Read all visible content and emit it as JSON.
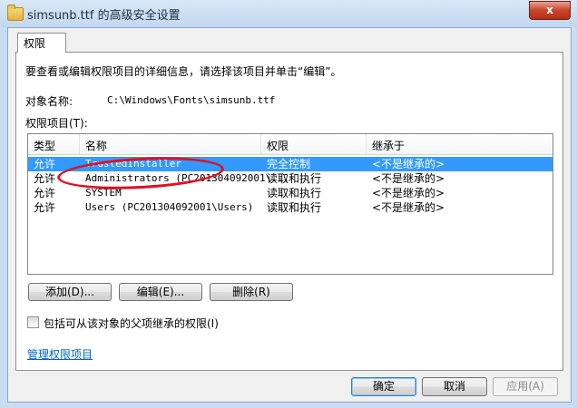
{
  "window": {
    "title": "simsunb.ttf 的高级安全设置",
    "close_label": "x"
  },
  "tab": {
    "label": "权限"
  },
  "intro": "要查看或编辑权限项目的详细信息，请选择该项目并单击“编辑”。",
  "object": {
    "label": "对象名称:",
    "value": "C:\\Windows\\Fonts\\simsunb.ttf"
  },
  "permission_entries_label": "权限项目(T):",
  "list": {
    "headers": [
      "类型",
      "名称",
      "权限",
      "继承于"
    ],
    "rows": [
      {
        "type": "允许",
        "name": "TrustedInstaller",
        "permission": "完全控制",
        "inherited": "<不是继承的>",
        "selected": true
      },
      {
        "type": "允许",
        "name": "Administrators (PC201304092001\\...",
        "permission": "读取和执行",
        "inherited": "<不是继承的>"
      },
      {
        "type": "允许",
        "name": "SYSTEM",
        "permission": "读取和执行",
        "inherited": "<不是继承的>"
      },
      {
        "type": "允许",
        "name": "Users (PC201304092001\\Users)",
        "permission": "读取和执行",
        "inherited": "<不是继承的>"
      }
    ]
  },
  "buttons": {
    "add": "添加(D)...",
    "edit": "编辑(E)...",
    "remove": "删除(R)",
    "ok": "确定",
    "cancel": "取消",
    "apply": "应用(A)"
  },
  "checkbox_label": "包括可从该对象的父项继承的权限(I)",
  "checkbox_checked": false,
  "manage_link": "管理权限项目",
  "colors": {
    "selection": "#3399ff",
    "link": "#0066cc",
    "annotation": "#e01020"
  }
}
